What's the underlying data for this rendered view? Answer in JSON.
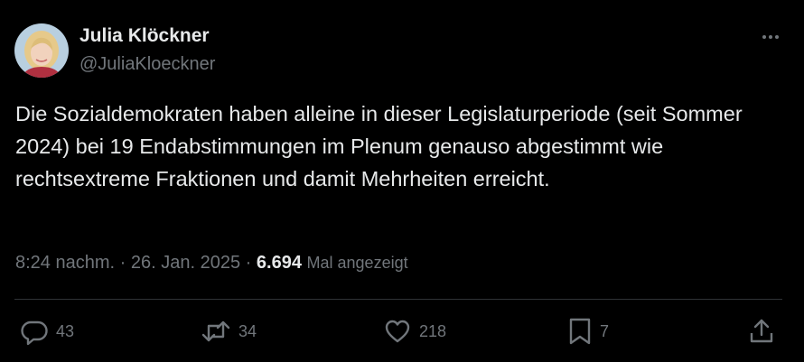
{
  "user": {
    "name": "Julia Klöckner",
    "handle": "@JuliaKloeckner"
  },
  "tweet": {
    "text": "Die Sozialdemokraten haben alleine in dieser Legislaturperiode (seit Sommer 2024) bei 19 Endabstimmungen im Plenum genauso abgestimmt wie rechtsextreme Fraktionen und damit Mehrheiten erreicht.",
    "time": "8:24 nachm.",
    "date": "26. Jan. 2025",
    "separator": "·",
    "views_count": "6.694",
    "views_label": "Mal angezeigt"
  },
  "actions": {
    "replies": "43",
    "reposts": "34",
    "likes": "218",
    "bookmarks": "7"
  },
  "icons": {
    "more": "more-horizontal-icon",
    "reply": "reply-icon",
    "repost": "repost-icon",
    "like": "heart-icon",
    "bookmark": "bookmark-icon",
    "share": "share-icon"
  },
  "colors": {
    "background": "#000000",
    "primary_text": "#e7e9ea",
    "secondary_text": "#71767b",
    "divider": "#2f3336"
  }
}
